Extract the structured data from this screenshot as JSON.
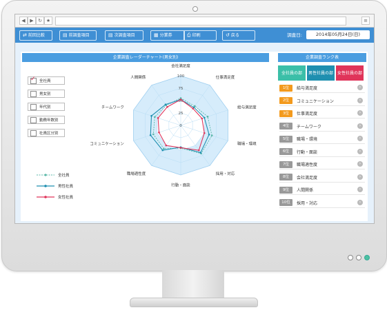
{
  "toolbar": {
    "buttons": [
      {
        "label": "前回比較",
        "icon": "compare-icon"
      },
      {
        "label": "前調査項目",
        "icon": "prev-icon"
      },
      {
        "label": "次調査項目",
        "icon": "next-icon"
      },
      {
        "label": "分業券",
        "icon": "book-icon"
      },
      {
        "label": "印刷",
        "icon": "print-icon"
      },
      {
        "label": "戻る",
        "icon": "back-icon"
      }
    ],
    "date_label": "調査日:",
    "date_value": "2014年05月24日(日)"
  },
  "main": {
    "title": "企業調査レーダーチャート(男女別)",
    "filters": [
      {
        "label": "全社員",
        "checked": true
      },
      {
        "label": "男女別",
        "checked": false
      },
      {
        "label": "年代別",
        "checked": false
      },
      {
        "label": "勤務年数別",
        "checked": false
      },
      {
        "label": "社員区分別",
        "checked": false
      }
    ],
    "legend": [
      {
        "label": "全社員",
        "color": "#5ab8a8"
      },
      {
        "label": "男性社員",
        "color": "#1f8fb0"
      },
      {
        "label": "女性社員",
        "color": "#e0345a"
      }
    ]
  },
  "chart_data": {
    "type": "radar",
    "title": "企業調査レーダーチャート(男女別)",
    "axes": [
      "会社満足度",
      "仕事満足度",
      "給与満足度",
      "職場・環境",
      "採用・対応",
      "行動・面談",
      "職場適性度",
      "コミュニケーション",
      "チームワーク",
      "人間関係"
    ],
    "r_ticks": [
      "0",
      "25",
      "50",
      "75",
      "100"
    ],
    "r_range": [
      0,
      100
    ],
    "series": [
      {
        "name": "全社員",
        "color": "#5ab8a8",
        "values": [
          55,
          48,
          57,
          66,
          70,
          46,
          58,
          58,
          55,
          50
        ]
      },
      {
        "name": "男性社員",
        "color": "#1f8fb0",
        "values": [
          52,
          45,
          50,
          60,
          68,
          44,
          62,
          64,
          62,
          52
        ]
      },
      {
        "name": "女性社員",
        "color": "#e0345a",
        "values": [
          52,
          42,
          45,
          50,
          62,
          45,
          50,
          46,
          48,
          46
        ]
      }
    ]
  },
  "side": {
    "title": "企業調査ランク表",
    "tabs": [
      {
        "label": "全社員の部",
        "color": "#3bbfa8"
      },
      {
        "label": "男性社員の部",
        "color": "#1f8fb0"
      },
      {
        "label": "女性社員の部",
        "color": "#e0345a"
      }
    ],
    "ranks": [
      {
        "rank": "1位",
        "label": "給与満足度",
        "color": "#f39a1d"
      },
      {
        "rank": "2位",
        "label": "コミュニケーション",
        "color": "#f39a1d"
      },
      {
        "rank": "3位",
        "label": "仕事満足度",
        "color": "#f39a1d"
      },
      {
        "rank": "4位",
        "label": "チームワーク",
        "color": "#999999"
      },
      {
        "rank": "5位",
        "label": "職場・環境",
        "color": "#999999"
      },
      {
        "rank": "6位",
        "label": "行動・面談",
        "color": "#999999"
      },
      {
        "rank": "7位",
        "label": "職場適性度",
        "color": "#999999"
      },
      {
        "rank": "8位",
        "label": "会社満足度",
        "color": "#999999"
      },
      {
        "rank": "9位",
        "label": "人間関係",
        "color": "#999999"
      },
      {
        "rank": "10位",
        "label": "採用・対応",
        "color": "#999999"
      }
    ]
  }
}
